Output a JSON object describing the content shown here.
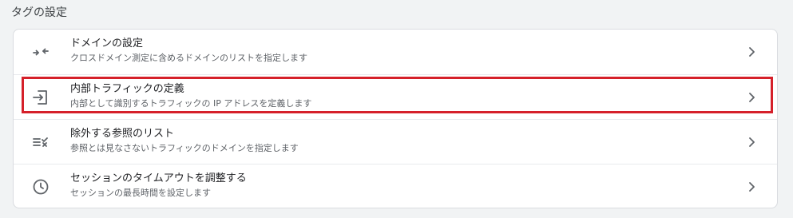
{
  "section": {
    "title": "タグの設定"
  },
  "rows": [
    {
      "title": "ドメインの設定",
      "desc": "クロスドメイン測定に含めるドメインのリストを指定します",
      "icon": "merge-arrows-icon"
    },
    {
      "title": "内部トラフィックの定義",
      "desc": "内部として識別するトラフィックの IP アドレスを定義します",
      "icon": "login-arrow-icon"
    },
    {
      "title": "除外する参照のリスト",
      "desc": "参照とは見なさないトラフィックのドメインを指定します",
      "icon": "list-exclude-icon"
    },
    {
      "title": "セッションのタイムアウトを調整する",
      "desc": "セッションの最長時間を設定します",
      "icon": "clock-icon"
    }
  ],
  "colors": {
    "highlight": "#d5202a",
    "icon": "#5f6368",
    "background": "#f1f3f4"
  }
}
